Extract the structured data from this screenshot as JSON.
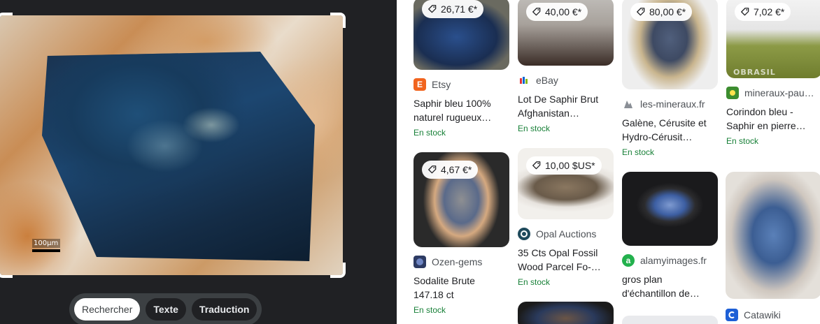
{
  "mode_toggle": {
    "search_label": "Rechercher",
    "text_label": "Texte",
    "translate_label": "Traduction"
  },
  "scale_bar": "100µm",
  "results": [
    {
      "price": "26,71 €*",
      "source": "Etsy",
      "favicon_letter": "E",
      "favicon_color": "#f1641e",
      "title": "Saphir bleu 100% naturel rugueux…",
      "stock": "En stock"
    },
    {
      "price": "40,00 €*",
      "source": "eBay",
      "favicon_letter": "",
      "favicon_color": "#ffffff",
      "title": "Lot De Saphir Brut Afghanistan…",
      "stock": "En stock"
    },
    {
      "price": "80,00 €*",
      "source": "les-mineraux.fr",
      "favicon_letter": "",
      "favicon_color": "#ffffff",
      "title": "Galène, Cérusite et Hydro-Cérusit…",
      "stock": "En stock"
    },
    {
      "price": "7,02 €*",
      "source": "mineraux-pau…",
      "favicon_letter": "",
      "favicon_color": "#3c8d2f",
      "title": "Corindon bleu - Saphir en pierre…",
      "stock": "En stock",
      "watermark": "OBRASIL"
    },
    {
      "price": "4,67 €*",
      "source": "Ozen-gems",
      "favicon_letter": "",
      "favicon_color": "#2d3b63",
      "title": "Sodalite Brute 147.18 ct",
      "stock": "En stock"
    },
    {
      "price": "10,00 $US*",
      "source": "Opal Auctions",
      "favicon_letter": "",
      "favicon_color": "#1f4a5c",
      "title": "35 Cts Opal Fossil Wood Parcel Fo-…",
      "stock": "En stock"
    },
    {
      "price": "",
      "source": "alamyimages.fr",
      "favicon_letter": "a",
      "favicon_color": "#23b14d",
      "title": "gros plan d'échantillon de…",
      "stock": ""
    },
    {
      "price": "",
      "source": "Catawiki",
      "favicon_letter": "",
      "favicon_color": "#1d5fd6",
      "title": "",
      "stock": ""
    }
  ],
  "colors": {
    "dark_bg": "#202124",
    "toggle_bg": "#3c4043",
    "stock_green": "#188038"
  }
}
